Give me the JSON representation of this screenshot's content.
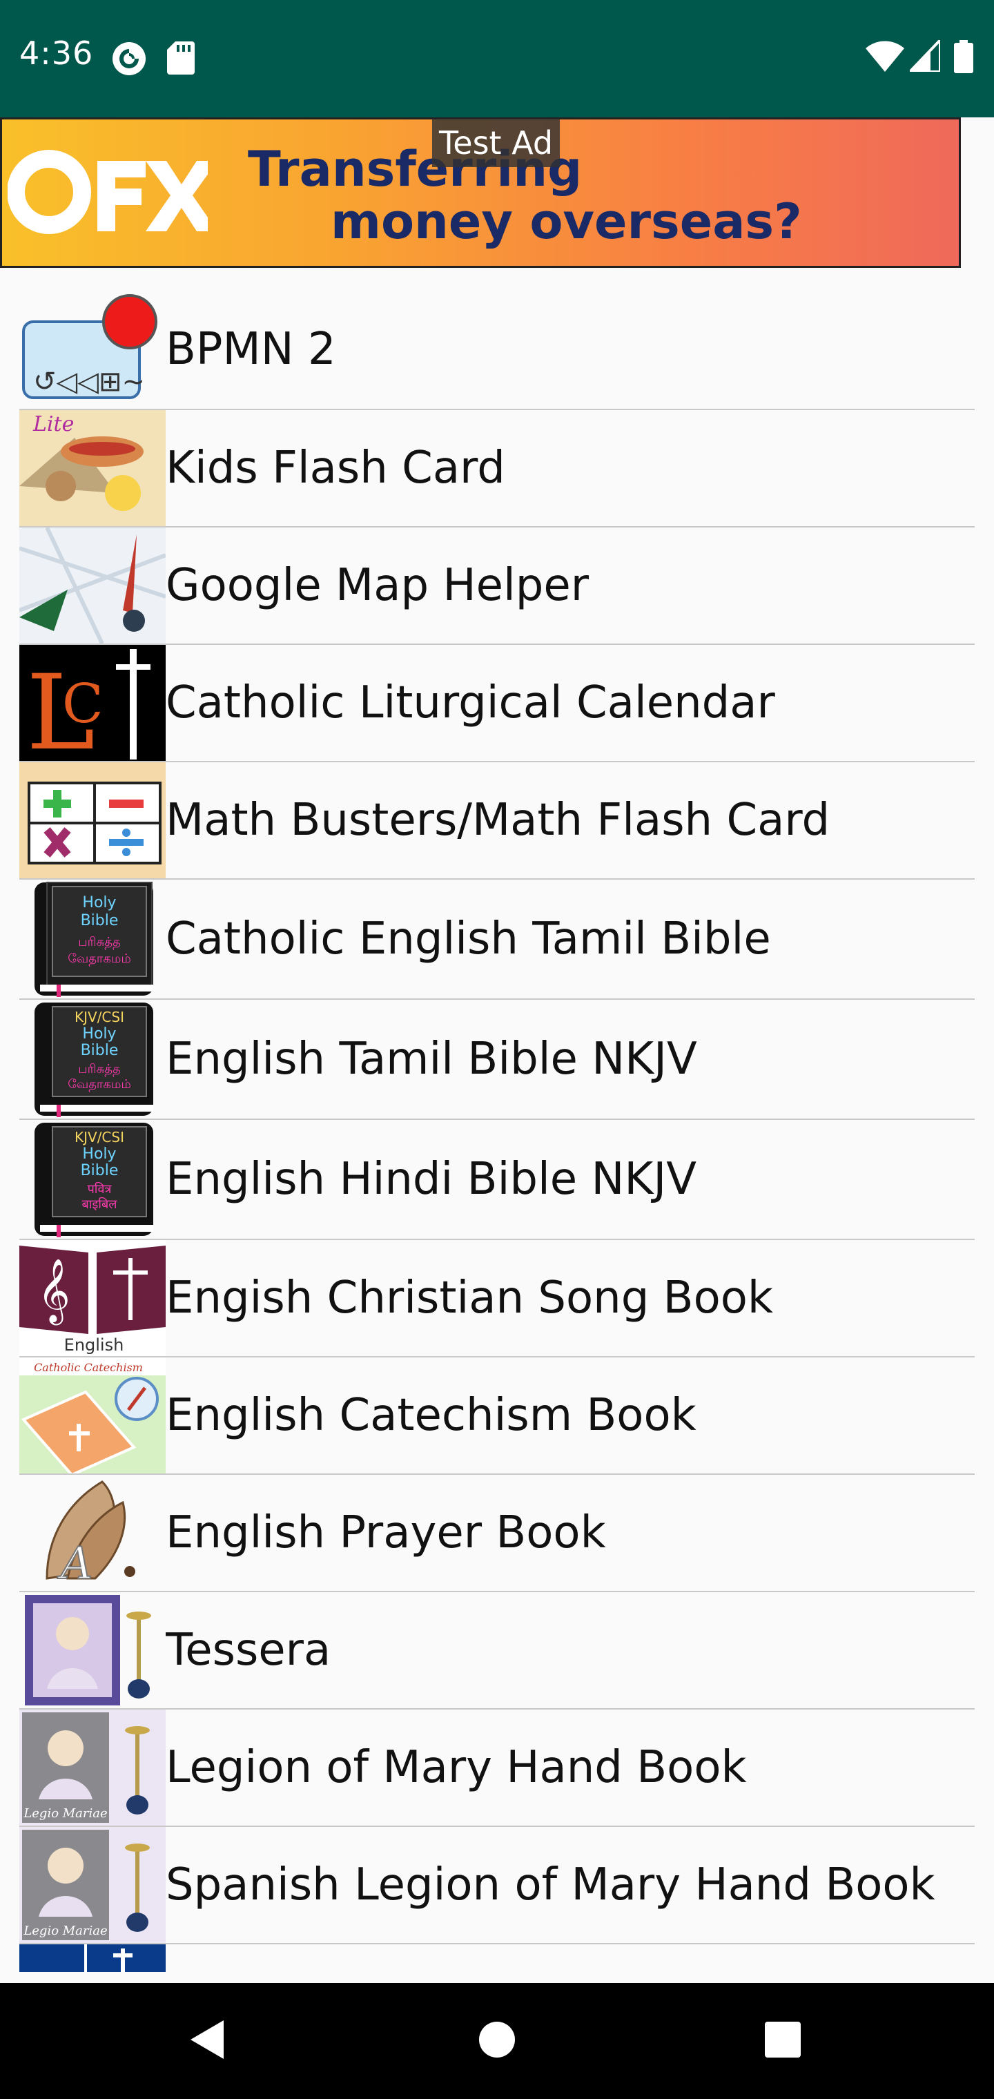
{
  "status_bar": {
    "time": "4:36",
    "background": "#00574b",
    "left_icons": [
      "pocket-casts-icon",
      "sd-card-icon"
    ],
    "right_icons": [
      "wifi-icon",
      "cell-signal-icon",
      "battery-icon"
    ]
  },
  "ad": {
    "badge": "Test Ad",
    "logo": "OFX",
    "headline_line1": "Transferring",
    "headline_line2": "money overseas?"
  },
  "apps": [
    {
      "label": "BPMN 2",
      "icon": "bpmn-icon"
    },
    {
      "label": "Kids Flash Card",
      "icon": "kids-flash-card-icon"
    },
    {
      "label": "Google Map Helper",
      "icon": "map-compass-icon"
    },
    {
      "label": "Catholic Liturgical Calendar",
      "icon": "lc-cross-icon"
    },
    {
      "label": "Math Busters/Math Flash Card",
      "icon": "math-symbols-icon"
    },
    {
      "label": "Catholic English Tamil Bible",
      "icon": "bible-book-icon",
      "cover_text": [
        "Holy",
        "Bible",
        "பரிசுத்த",
        "வேதாகமம்"
      ]
    },
    {
      "label": "English Tamil Bible NKJV",
      "icon": "bible-book-icon",
      "cover_text": [
        "KJV/CSI",
        "Holy",
        "Bible",
        "பரிசுத்த",
        "வேதாகமம்"
      ]
    },
    {
      "label": "English Hindi Bible NKJV",
      "icon": "bible-book-icon",
      "cover_text": [
        "KJV/CSI",
        "Holy",
        "Bible",
        "पवित्र",
        "बाइबिल"
      ]
    },
    {
      "label": "Engish Christian Song Book",
      "icon": "song-book-icon",
      "caption": "English"
    },
    {
      "label": "English Catechism Book",
      "icon": "catechism-book-icon",
      "caption": "Catholic Catechism"
    },
    {
      "label": "English Prayer Book",
      "icon": "praying-hands-icon"
    },
    {
      "label": "Tessera",
      "icon": "tessera-icon"
    },
    {
      "label": "Legion of Mary Hand Book",
      "icon": "legion-icon",
      "caption": "Legio Mariae"
    },
    {
      "label": "Spanish Legion of Mary Hand Book",
      "icon": "legion-icon",
      "caption": "Legio Mariae"
    }
  ],
  "nav": {
    "back": "back-icon",
    "home": "home-icon",
    "recents": "recents-icon"
  }
}
